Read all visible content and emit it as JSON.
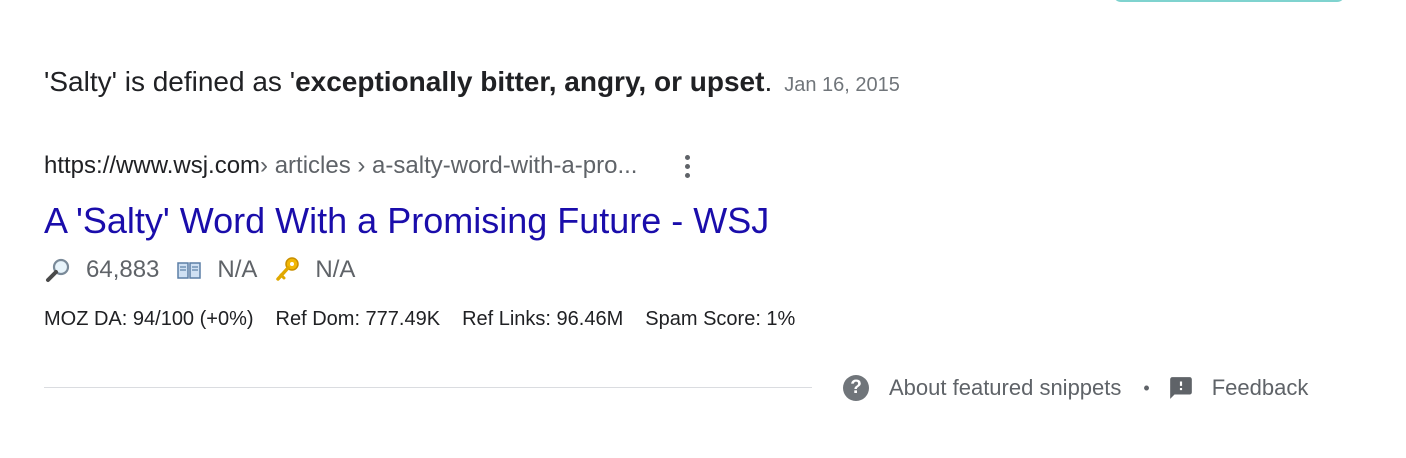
{
  "snippet": {
    "prefix": "'Salty' is defined as '",
    "bold": "exceptionally bitter, angry, or upset",
    "suffix": ".",
    "date": "Jan 16, 2015"
  },
  "result": {
    "cite_domain": "https://www.wsj.com",
    "cite_path": " › articles › a-salty-word-with-a-pro...",
    "title": "A 'Salty' Word With a Promising Future - WSJ",
    "metrics": {
      "search_volume": "64,883",
      "book_value": "N/A",
      "key_value": "N/A"
    },
    "moz": {
      "da": "MOZ DA: 94/100 (+0%)",
      "ref_dom": "Ref Dom: 777.49K",
      "ref_links": "Ref Links: 96.46M",
      "spam_score": "Spam Score: 1%"
    }
  },
  "footer": {
    "about_label": "About featured snippets",
    "separator": "•",
    "feedback_label": "Feedback"
  },
  "icons": {
    "more": "more-vert-icon",
    "magnifier": "magnifying-glass-icon",
    "book": "book-icon",
    "key": "key-icon",
    "help": "help-circle-icon",
    "feedback": "feedback-icon"
  },
  "colors": {
    "link": "#1a0dab",
    "text": "#202124",
    "muted": "#5f6368"
  }
}
